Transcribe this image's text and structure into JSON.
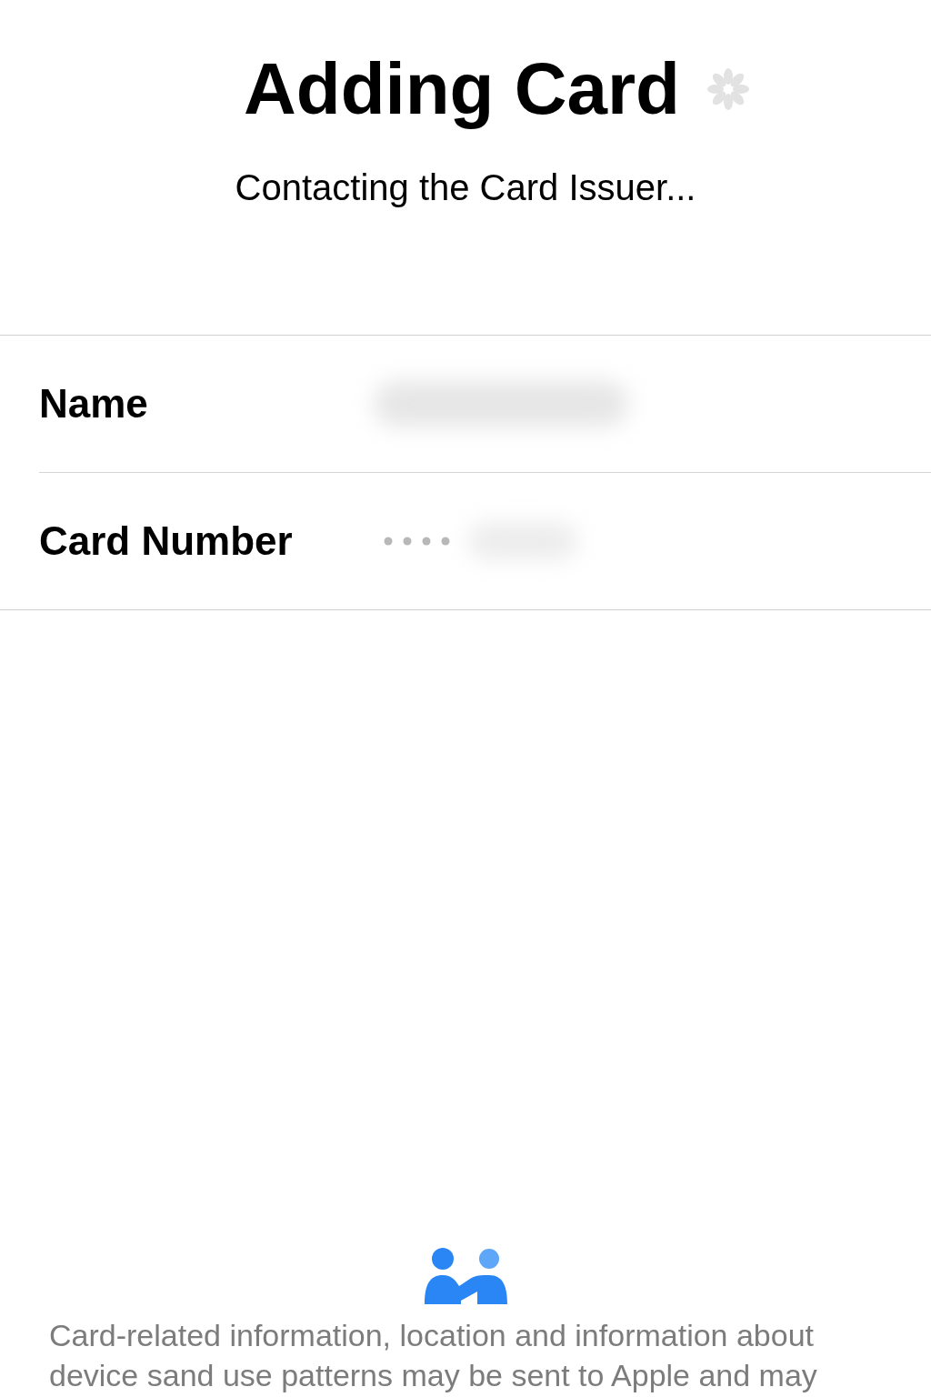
{
  "header": {
    "title": "Adding Card",
    "loading": true,
    "subtitle": "Contacting the Card Issuer..."
  },
  "fields": [
    {
      "label": "Name",
      "kind": "text"
    },
    {
      "label": "Card Number",
      "kind": "card_number"
    }
  ],
  "footer": {
    "text": "Card-related information, location and information about device sand use patterns may be sent to Apple and may"
  }
}
